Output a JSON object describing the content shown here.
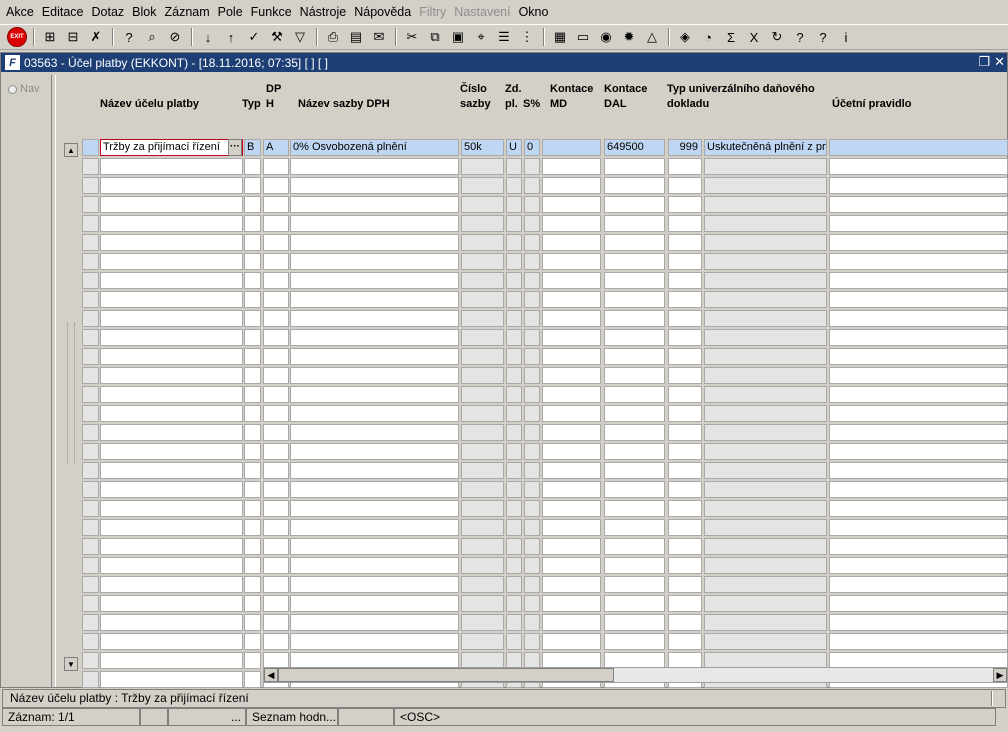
{
  "menu": [
    {
      "label": "Akce",
      "enabled": true
    },
    {
      "label": "Editace",
      "enabled": true
    },
    {
      "label": "Dotaz",
      "enabled": true
    },
    {
      "label": "Blok",
      "enabled": true
    },
    {
      "label": "Záznam",
      "enabled": true
    },
    {
      "label": "Pole",
      "enabled": true
    },
    {
      "label": "Funkce",
      "enabled": true
    },
    {
      "label": "Nástroje",
      "enabled": true
    },
    {
      "label": "Nápověda",
      "enabled": true
    },
    {
      "label": "Filtry",
      "enabled": false
    },
    {
      "label": "Nastavení",
      "enabled": false
    },
    {
      "label": "Okno",
      "enabled": true
    }
  ],
  "toolbar": {
    "exit_label": "EXIT",
    "groups": [
      [
        "insert-record-icon",
        "delete-record-icon",
        "clear-record-icon"
      ],
      [
        "query-icon",
        "execute-query-icon",
        "cancel-query-icon"
      ],
      [
        "sort-asc-icon",
        "sort-desc-icon",
        "accept-icon",
        "tools-icon",
        "filter-icon"
      ],
      [
        "print-icon",
        "print-preview-icon",
        "email-icon"
      ],
      [
        "cut-icon",
        "copy-icon",
        "paste-icon",
        "find-icon",
        "list-icon",
        "tree-icon"
      ],
      [
        "open-icon",
        "document-icon",
        "globe-icon",
        "settings-icon",
        "warning-icon"
      ],
      [
        "chart-icon",
        "calc-icon",
        "sum-icon",
        "excel-icon",
        "refresh-icon",
        "help-icon",
        "context-help-icon",
        "info-icon"
      ]
    ],
    "glyphs": {
      "insert-record-icon": "⊞",
      "delete-record-icon": "⊟",
      "clear-record-icon": "✗",
      "query-icon": "?",
      "execute-query-icon": "⌕",
      "cancel-query-icon": "⊘",
      "sort-asc-icon": "↓",
      "sort-desc-icon": "↑",
      "accept-icon": "✓",
      "tools-icon": "⚒",
      "filter-icon": "▽",
      "print-icon": "⎙",
      "print-preview-icon": "▤",
      "email-icon": "✉",
      "cut-icon": "✂",
      "copy-icon": "⧉",
      "paste-icon": "▣",
      "find-icon": "⌖",
      "list-icon": "☰",
      "tree-icon": "⋮",
      "open-icon": "▦",
      "document-icon": "▭",
      "globe-icon": "◉",
      "settings-icon": "✹",
      "warning-icon": "△",
      "chart-icon": "◈",
      "calc-icon": "◔",
      "sum-icon": "Σ",
      "excel-icon": "X",
      "refresh-icon": "↻",
      "help-icon": "?",
      "context-help-icon": "?",
      "info-icon": "i"
    }
  },
  "window": {
    "title": "03563 - Účel platby (EKKONT) - [18.11.2016; 07:35]  [ ]  [ ]"
  },
  "nav": {
    "label": "Nav"
  },
  "grid": {
    "headers": {
      "nazev": "Název účelu platby",
      "typ": "Typ",
      "dph": "DP\nH",
      "sazba_nazev": "Název sazby DPH",
      "cislo_sazby": "Číslo\nsazby",
      "zd_pl": "Zd.\npl.",
      "s_pct": "S%",
      "kontace_md": "Kontace\nMD",
      "kontace_dal": "Kontace\nDAL",
      "typ_dokladu": "Typ univerzálního daňového\ndokladu",
      "ucetni_pravidlo": "Účetní pravidlo"
    },
    "rows": [
      {
        "nazev": "Tržby za přijímací řízení",
        "typ": "B",
        "dph": "A",
        "sazba_nazev": "0% Osvobozená plnění",
        "cislo_sazby": "50k",
        "zd_pl": "U",
        "s_pct": "0",
        "kontace_md": "",
        "kontace_dal": "649500",
        "typ_kod": "999",
        "typ_dokladu": "Uskutečněná plnění z prv",
        "ucetni_pravidlo": ""
      }
    ],
    "empty_rows": 28
  },
  "status": {
    "message": "Název účelu platby : Tržby za přijímací řízení",
    "record": "Záznam: 1/1",
    "cell2": "",
    "cell3": "...",
    "list_values": "Seznam hodn...",
    "cell5": "",
    "mode": "<OSC>"
  }
}
